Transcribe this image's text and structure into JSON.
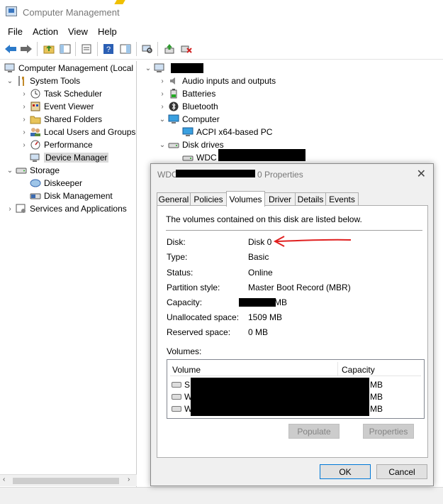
{
  "window": {
    "title": "Computer Management"
  },
  "menu": {
    "items": [
      "File",
      "Action",
      "View",
      "Help"
    ]
  },
  "toolbar": {
    "icons": [
      "back-arrow-icon",
      "forward-arrow-icon",
      "folder-up-icon",
      "console-tree-icon",
      "properties-sheet-icon",
      "help-icon",
      "action-pane-icon",
      "scan-hardware-icon",
      "update-driver-icon",
      "uninstall-device-icon"
    ]
  },
  "tree": {
    "root": "Computer Management (Local",
    "system_tools": "System Tools",
    "task_scheduler": "Task Scheduler",
    "event_viewer": "Event Viewer",
    "shared_folders": "Shared Folders",
    "local_users": "Local Users and Groups",
    "performance": "Performance",
    "device_manager": "Device Manager",
    "storage": "Storage",
    "diskeeper": "Diskeeper",
    "disk_management": "Disk Management",
    "services": "Services and Applications"
  },
  "devices": {
    "audio": "Audio inputs and outputs",
    "batteries": "Batteries",
    "bluetooth": "Bluetooth",
    "computer": "Computer",
    "acpi": "ACPI x64-based PC",
    "disk_drives": "Disk drives",
    "wdc": "WDC"
  },
  "dialog": {
    "title_prefix": "WDC",
    "title_suffix": "0 Properties",
    "tabs": [
      "General",
      "Policies",
      "Volumes",
      "Driver",
      "Details",
      "Events"
    ],
    "active_tab": "Volumes",
    "intro": "The volumes contained on this disk are listed below.",
    "labels": {
      "disk": "Disk:",
      "type": "Type:",
      "status": "Status:",
      "partition": "Partition style:",
      "capacity": "Capacity:",
      "unallocated": "Unallocated space:",
      "reserved": "Reserved space:"
    },
    "values": {
      "disk": "Disk 0",
      "type": "Basic",
      "status": "Online",
      "partition": "Master Boot Record (MBR)",
      "capacity_suffix": "MB",
      "unallocated": "1509 MB",
      "reserved": "0 MB"
    },
    "volumes_label": "Volumes:",
    "volumes_columns": [
      "Volume",
      "Capacity"
    ],
    "volumes_rows": [
      {
        "name_prefix": "SF",
        "unit": "MB"
      },
      {
        "name_prefix": "W",
        "unit": "MB"
      },
      {
        "name_prefix": "W",
        "unit": "MB"
      }
    ],
    "buttons": {
      "populate": "Populate",
      "properties": "Properties",
      "ok": "OK",
      "cancel": "Cancel"
    },
    "close_glyph": "✕"
  },
  "colors": {
    "annotation_arrow": "#e02020",
    "selection": "#d9d9d9",
    "accent": "#0078d7"
  }
}
